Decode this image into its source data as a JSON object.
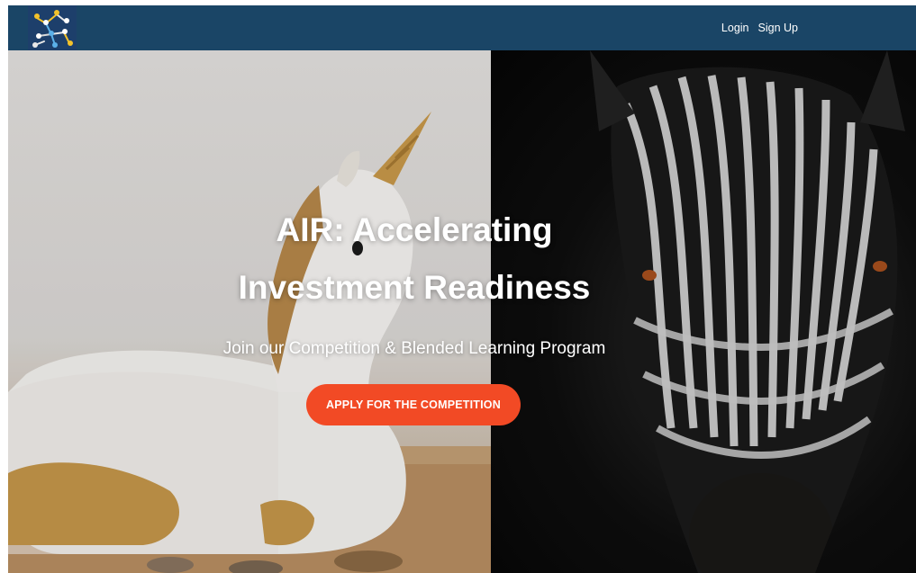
{
  "nav": {
    "logo_icon": "people-network-logo-icon",
    "login_label": "Login",
    "signup_label": "Sign Up",
    "background_color": "#1a4566"
  },
  "hero": {
    "title_line1": "AIR: Accelerating",
    "title_line2": "Investment Readiness",
    "subtitle": "Join our Competition & Blended Learning Program",
    "cta_label": "APPLY FOR THE COMPETITION",
    "cta_color": "#f24a25",
    "left_image": "unicorn-piggy-bank-image",
    "right_image": "zebra-portrait-image"
  }
}
